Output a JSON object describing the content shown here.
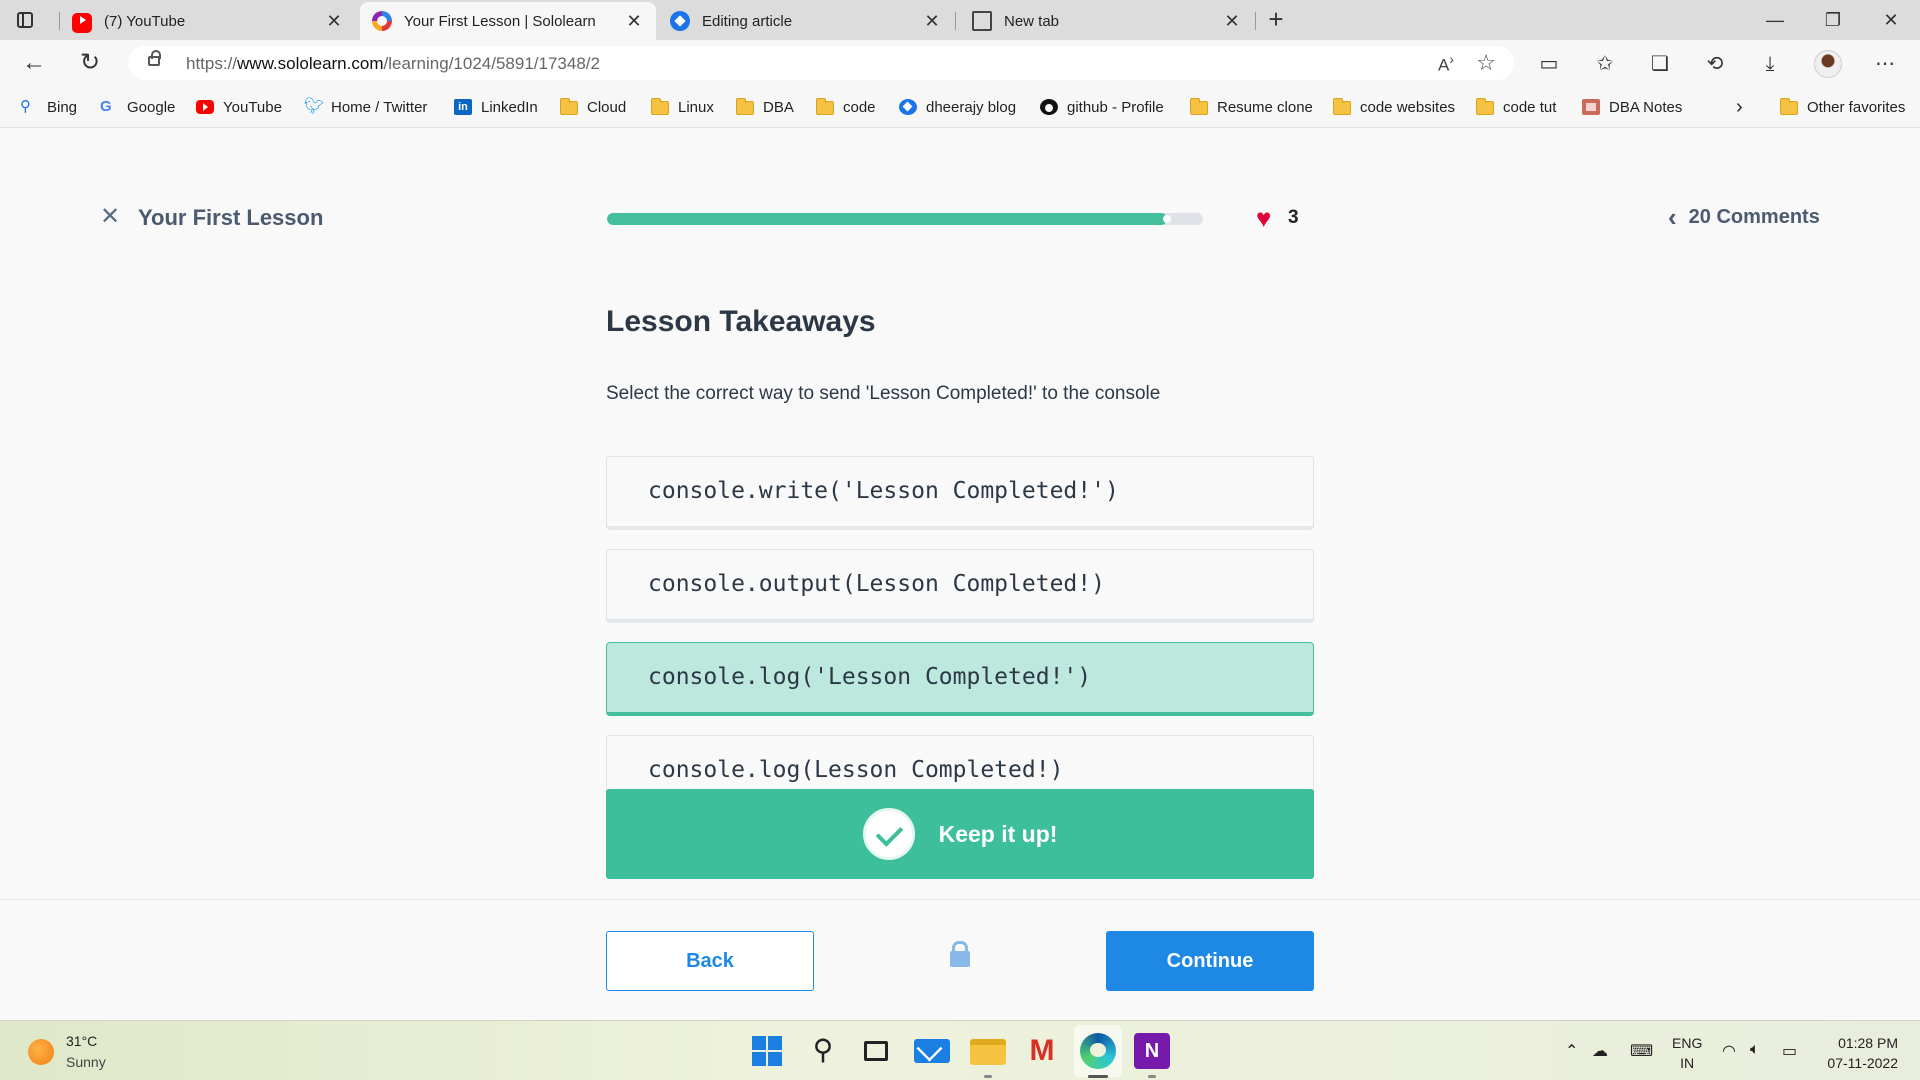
{
  "browser": {
    "tabs": [
      {
        "title": "(7) YouTube",
        "icon": "youtube-icon"
      },
      {
        "title": "Your First Lesson | Sololearn",
        "icon": "sololearn-icon",
        "active": true
      },
      {
        "title": "Editing article",
        "icon": "editor-icon"
      },
      {
        "title": "New tab",
        "icon": "document-icon"
      }
    ],
    "url_prefix": "https://",
    "url_domain": "www.sololearn.com",
    "url_path": "/learning/1024/5891/17348/2",
    "favorites": [
      {
        "label": "Bing",
        "icon": "bing-icon"
      },
      {
        "label": "Google",
        "icon": "google-icon"
      },
      {
        "label": "YouTube",
        "icon": "youtube-icon"
      },
      {
        "label": "Home / Twitter",
        "icon": "twitter-icon"
      },
      {
        "label": "LinkedIn",
        "icon": "linkedin-icon"
      },
      {
        "label": "Cloud",
        "icon": "folder-icon"
      },
      {
        "label": "Linux",
        "icon": "folder-icon"
      },
      {
        "label": "DBA",
        "icon": "folder-icon"
      },
      {
        "label": "code",
        "icon": "folder-icon"
      },
      {
        "label": "dheerajy blog",
        "icon": "blog-icon"
      },
      {
        "label": "github - Profile",
        "icon": "github-icon"
      },
      {
        "label": "Resume clone",
        "icon": "folder-icon"
      },
      {
        "label": "code websites",
        "icon": "folder-icon"
      },
      {
        "label": "code tut",
        "icon": "folder-icon"
      },
      {
        "label": "DBA Notes",
        "icon": "notes-icon"
      }
    ],
    "other_favorites": "Other favorites"
  },
  "lesson": {
    "title": "Your First Lesson",
    "progress": 0.94,
    "hearts": "3",
    "comments": "20 Comments",
    "section_title": "Lesson Takeaways",
    "question": "Select the correct way to send 'Lesson Completed!' to the console",
    "options": [
      {
        "text": "console.write('Lesson Completed!')",
        "selected": false
      },
      {
        "text": "console.output(Lesson Completed!)",
        "selected": false
      },
      {
        "text": "console.log('Lesson Completed!')",
        "selected": true
      },
      {
        "text": "console.log(Lesson Completed!)",
        "selected": false
      }
    ],
    "feedback": "Keep it up!",
    "back_label": "Back",
    "continue_label": "Continue"
  },
  "colors": {
    "accent_green": "#3dbf9c",
    "selected_bg": "#bde8de",
    "primary_blue": "#1e88e5",
    "heart_red": "#e4003a"
  },
  "taskbar": {
    "temperature": "31°C",
    "weather": "Sunny",
    "lang_top": "ENG",
    "lang_bottom": "IN",
    "time": "01:28 PM",
    "date": "07-11-2022"
  }
}
